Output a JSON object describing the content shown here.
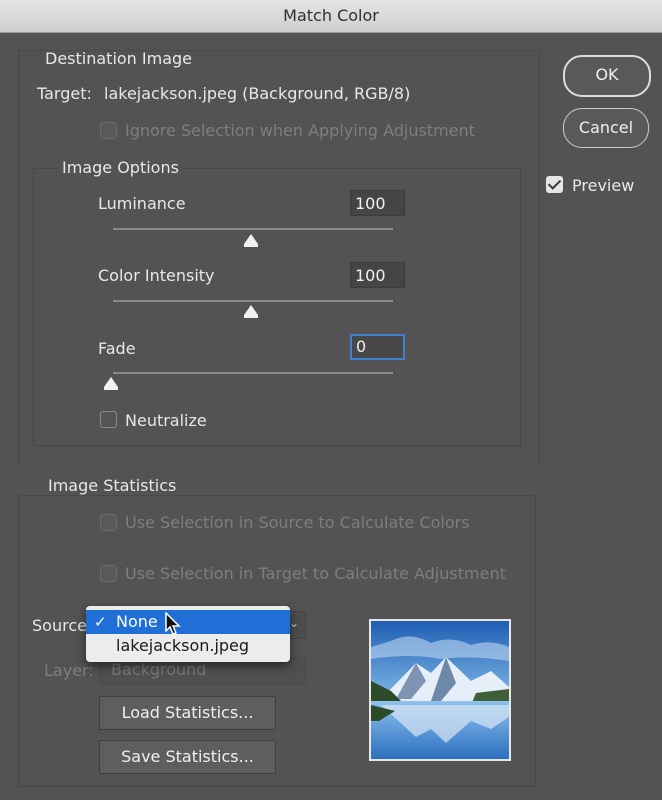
{
  "window": {
    "title": "Match Color"
  },
  "buttons": {
    "ok": "OK",
    "cancel": "Cancel",
    "preview_label": "Preview",
    "preview_checked": true
  },
  "destination": {
    "title": "Destination Image",
    "target_label": "Target:",
    "target_value": "lakejackson.jpeg (Background, RGB/8)",
    "ignore_selection": "Ignore Selection when Applying Adjustment"
  },
  "image_options": {
    "title": "Image Options",
    "luminance_label": "Luminance",
    "luminance_value": "100",
    "luminance_level": 0.5,
    "color_intensity_label": "Color Intensity",
    "color_intensity_value": "100",
    "color_intensity_level": 0.5,
    "fade_label": "Fade",
    "fade_value": "0",
    "fade_level": 0,
    "neutralize_label": "Neutralize"
  },
  "statistics": {
    "title": "Image Statistics",
    "use_selection_source": "Use Selection in Source to Calculate Colors",
    "use_selection_target": "Use Selection in Target to Calculate Adjustment",
    "source_label": "Source",
    "layer_label": "Layer:",
    "layer_value": "Background",
    "load_button": "Load Statistics...",
    "save_button": "Save Statistics..."
  },
  "source_menu": {
    "options": [
      {
        "label": "None",
        "selected": true
      },
      {
        "label": "lakejackson.jpeg",
        "selected": false
      }
    ],
    "check_glyph": "✓"
  },
  "colors": {
    "accent": "#1f6fd6",
    "focus": "#3d7fd1",
    "background": "#535353"
  }
}
